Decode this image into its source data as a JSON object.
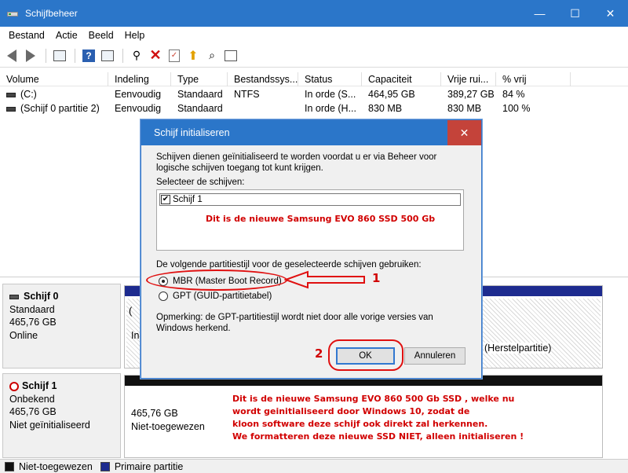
{
  "window": {
    "title": "Schijfbeheer",
    "minimize": "—",
    "maximize": "☐",
    "close": "✕"
  },
  "menu": [
    "Bestand",
    "Actie",
    "Beeld",
    "Help"
  ],
  "toolbar": {
    "icons": [
      "back-icon",
      "forward-icon",
      "properties-icon",
      "help-icon",
      "view-icon",
      "connect-icon",
      "delete-icon",
      "check-icon",
      "up-icon",
      "search-icon",
      "list-icon"
    ]
  },
  "volume_list": {
    "columns": [
      "Volume",
      "Indeling",
      "Type",
      "Bestandssys...",
      "Status",
      "Capaciteit",
      "Vrije rui...",
      "% vrij"
    ],
    "rows": [
      [
        "(C:)",
        "Eenvoudig",
        "Standaard",
        "NTFS",
        "In orde (S...",
        "464,95 GB",
        "389,27 GB",
        "84 %"
      ],
      [
        "(Schijf 0 partitie 2)",
        "Eenvoudig",
        "Standaard",
        "",
        "In orde (H...",
        "830 MB",
        "830 MB",
        "100 %"
      ]
    ]
  },
  "disks": [
    {
      "name": "Schijf 0",
      "type": "Standaard",
      "size": "465,76 GB",
      "status": "Online",
      "partition_fragment_1": "(",
      "partition_fragment_2": "In",
      "partition_right": "(Herstelpartitie)"
    },
    {
      "name": "Schijf 1",
      "type": "Onbekend",
      "size": "465,76 GB",
      "status": "Niet geïnitialiseerd",
      "unallocated_size": "465,76 GB",
      "unallocated_label": "Niet-toegewezen"
    }
  ],
  "legend": [
    {
      "label": "Niet-toegewezen",
      "color": "#111111"
    },
    {
      "label": "Primaire partitie",
      "color": "#1d2b8f"
    }
  ],
  "dialog": {
    "title": "Schijf initialiseren",
    "close": "✕",
    "intro": "Schijven dienen geïnitialiseerd te worden voordat u er via Beheer voor logische schijven toegang tot kunt krijgen.",
    "select_label": "Selecteer de schijven:",
    "disk_item": "Schijf 1",
    "disk_checked": "✔",
    "partition_style_label": "De volgende partitiestijl voor de geselecteerde schijven gebruiken:",
    "option_mbr": "MBR (Master Boot Record)",
    "option_gpt": "GPT (GUID-partitietabel)",
    "note": "Opmerking: de GPT-partitiestijl wordt niet door alle vorige versies van Windows herkend.",
    "ok": "OK",
    "cancel": "Annuleren"
  },
  "annotations": {
    "listbox_note": "Dit is de nieuwe Samsung EVO 860 SSD 500 Gb",
    "marker_1": "1",
    "marker_2": "2",
    "bottom_note": [
      "Dit is de nieuwe Samsung EVO 860 500 Gb SSD , welke nu",
      "wordt geinitialiseerd door Windows 10, zodat de",
      "kloon software deze schijf ook direkt zal herkennen.",
      "We formatteren deze nieuwe SSD NIET, alleen initialiseren !"
    ],
    "color": "#d10000"
  }
}
